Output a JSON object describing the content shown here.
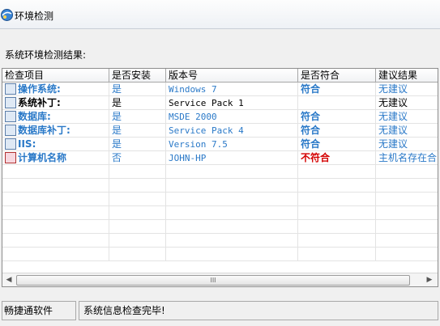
{
  "window": {
    "title": "环境检测"
  },
  "section_label": "系统环境检测结果:",
  "table": {
    "columns": [
      "检查项目",
      "是否安装",
      "版本号",
      "是否符合",
      "建议结果"
    ],
    "rows": [
      {
        "item": "操作系统:",
        "installed": "是",
        "version": "Windows 7",
        "match": "符合",
        "advice": "无建议",
        "icon": "monitor-icon",
        "style": "blue"
      },
      {
        "item": "系统补丁:",
        "installed": "是",
        "version": "Service Pack 1",
        "match": "",
        "advice": "无建议",
        "icon": "patch-icon",
        "style": "black"
      },
      {
        "item": "数据库:",
        "installed": "是",
        "version": "MSDE 2000",
        "match": "符合",
        "advice": "无建议",
        "icon": "database-icon",
        "style": "blue"
      },
      {
        "item": "数据库补丁:",
        "installed": "是",
        "version": "Service Pack 4",
        "match": "符合",
        "advice": "无建议",
        "icon": "database-patch-icon",
        "style": "blue"
      },
      {
        "item": "IIS:",
        "installed": "是",
        "version": "Version 7.5",
        "match": "符合",
        "advice": "无建议",
        "icon": "iis-icon",
        "style": "blue"
      },
      {
        "item": "计算机名称",
        "installed": "否",
        "version": "JOHN-HP",
        "match": "不符合",
        "advice": "主机名存在合",
        "icon": "computer-name-icon",
        "style": "warn"
      }
    ]
  },
  "scrollbar": {
    "thumb_grip": "III"
  },
  "status": {
    "left": "畅捷通软件",
    "right": "系统信息检查完毕!"
  },
  "colors": {
    "accent_blue": "#2a79c8",
    "warn_red": "#d40000"
  }
}
